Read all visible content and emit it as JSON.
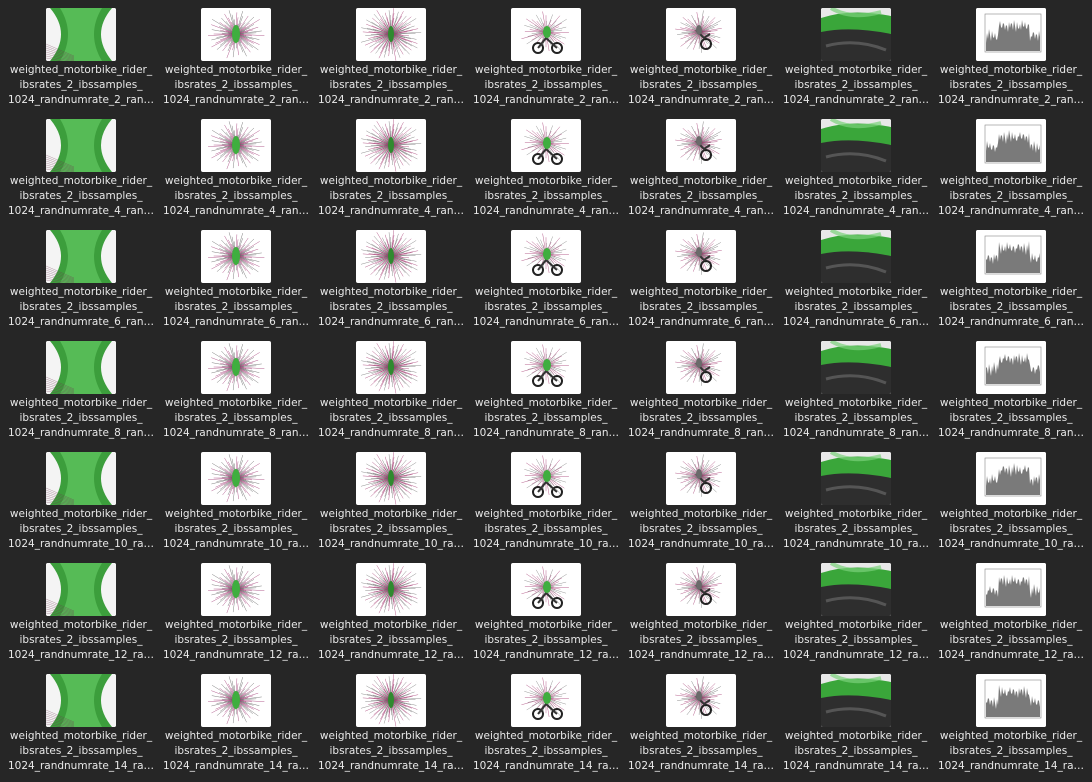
{
  "colors": {
    "background": "#262626",
    "label_text": "#e8e8e8",
    "thumb_bg": "#ffffff",
    "green": "#3fae3f",
    "magenta": "#a0306a",
    "dark": "#2a2a2a"
  },
  "column_types": [
    "green-cylinder",
    "spiky-green",
    "spiky-radial",
    "motorbike-front",
    "motorbike-side",
    "green-dark-closeup",
    "histogram-plot"
  ],
  "rows": [
    {
      "label_lines": [
        "weighted_motorbike_rider_",
        "ibsrates_2_ibssamples_",
        "1024_randnumrate_2_ran…"
      ]
    },
    {
      "label_lines": [
        "weighted_motorbike_rider_",
        "ibsrates_2_ibssamples_",
        "1024_randnumrate_4_ran…"
      ]
    },
    {
      "label_lines": [
        "weighted_motorbike_rider_",
        "ibsrates_2_ibssamples_",
        "1024_randnumrate_6_ran…"
      ]
    },
    {
      "label_lines": [
        "weighted_motorbike_rider_",
        "ibsrates_2_ibssamples_",
        "1024_randnumrate_8_ran…"
      ]
    },
    {
      "label_lines": [
        "weighted_motorbike_rider_",
        "ibsrates_2_ibssamples_",
        "1024_randnumrate_10_ra…"
      ]
    },
    {
      "label_lines": [
        "weighted_motorbike_rider_",
        "ibsrates_2_ibssamples_",
        "1024_randnumrate_12_ra…"
      ]
    },
    {
      "label_lines": [
        "weighted_motorbike_rider_",
        "ibsrates_2_ibssamples_",
        "1024_randnumrate_14_ra…"
      ]
    }
  ]
}
